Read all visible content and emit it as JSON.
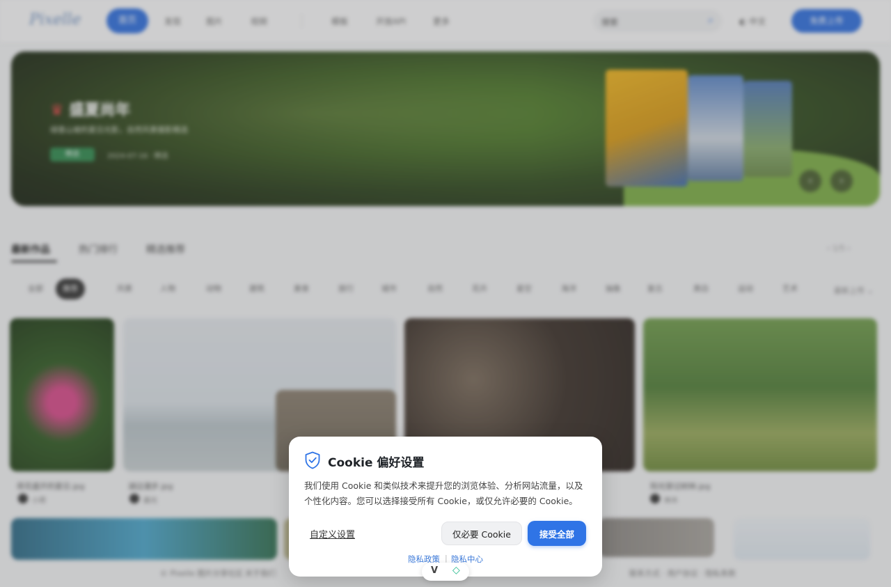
{
  "nav": {
    "logo": "Pixelle",
    "items": [
      "首页",
      "发现",
      "图片",
      "视频",
      "模板",
      "开放API",
      "更多"
    ],
    "search_placeholder": "搜索",
    "lang": "中文",
    "cta": "免费上传"
  },
  "hero": {
    "title": "盛夏尚年",
    "subtitle": "绿意山坡的夏日光影，自然风景摄影精选",
    "badge": "精选",
    "meta": "2024-07-16 · 精选"
  },
  "tabs": [
    "最新作品",
    "热门排行",
    "精选推荐"
  ],
  "tabs_right": "‹ 1/5 ›",
  "chips": [
    "全部",
    "推荐",
    "风景",
    "人物",
    "动物",
    "建筑",
    "美食",
    "旅行",
    "城市",
    "自然",
    "花卉",
    "星空",
    "海洋",
    "抽象",
    "复古",
    "黑白",
    "运动",
    "艺术"
  ],
  "sort_label": "最新上传 ⌄",
  "cards": [
    {
      "title": "荷花盛开的夏日.jpg",
      "author": "小荷"
    },
    {
      "title": "湖边漫步.jpg",
      "author": "晨光"
    },
    {
      "title": "",
      "author": ""
    },
    {
      "title": "阳光穿过树林.jpg",
      "author": "林木"
    }
  ],
  "footer_texts": [
    "© Pixelle 图片分享社区",
    "关于我们",
    "联系方式 · 用户协议 · 隐私条款"
  ],
  "cookie": {
    "title": "Cookie 偏好设置",
    "body": "我们使用 Cookie 和类似技术来提升您的浏览体验、分析网站流量，以及个性化内容。您可以选择接受所有 Cookie，或仅允许必要的 Cookie。",
    "customize": "自定义设置",
    "necessary_only": "仅必要 Cookie",
    "accept_all": "接受全部",
    "privacy_policy": "隐私政策",
    "privacy_center": "隐私中心",
    "separator": "|"
  },
  "float_badge": {
    "left": "V",
    "right": "◇"
  },
  "colors": {
    "primary": "#2f74e6",
    "shield": "#2f74e6",
    "link": "#3a78d8"
  }
}
